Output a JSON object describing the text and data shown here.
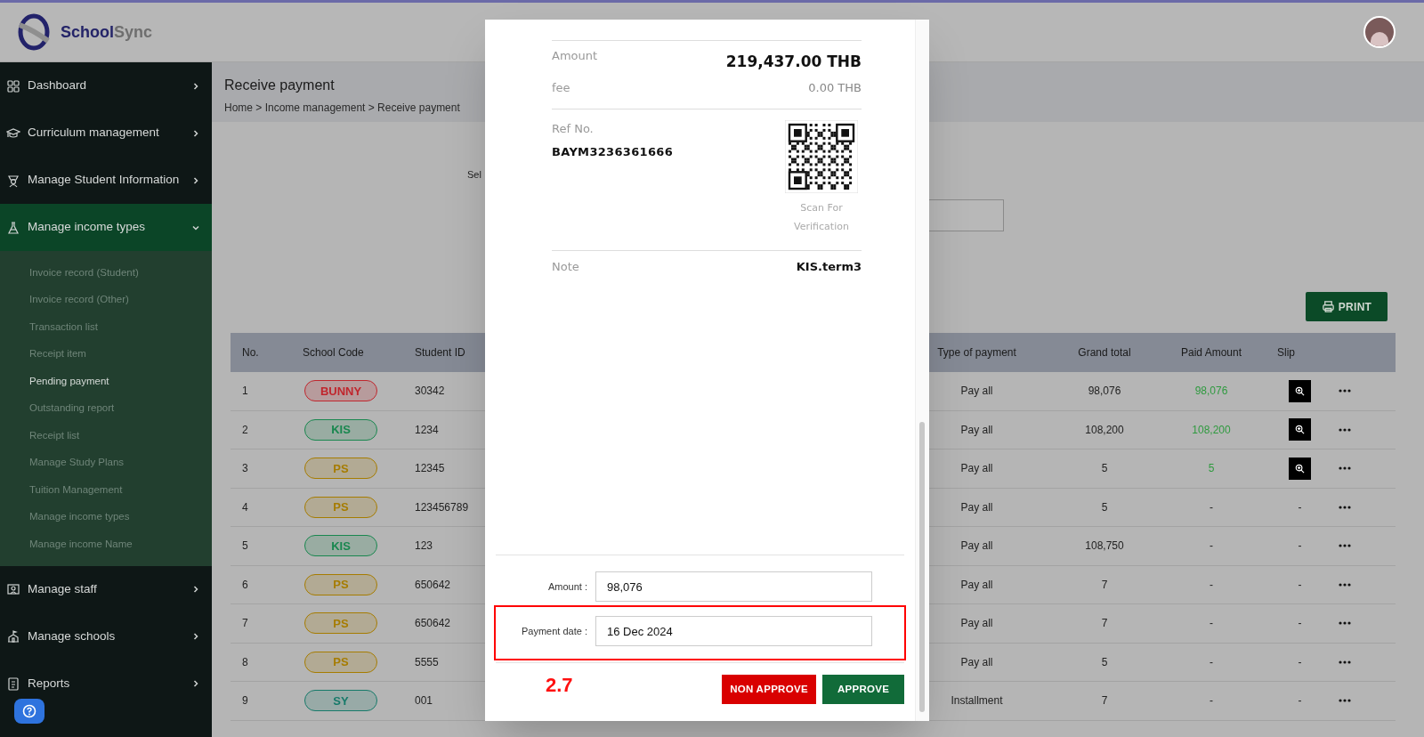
{
  "logo": {
    "primary": "School",
    "secondary": "Sync"
  },
  "sidebar": {
    "items": [
      {
        "label": "Dashboard",
        "expanded": false
      },
      {
        "label": "Curriculum management",
        "expanded": false
      },
      {
        "label": "Manage Student Information",
        "expanded": false
      },
      {
        "label": "Manage income types",
        "expanded": true,
        "children": [
          {
            "label": "Invoice record (Student)",
            "selected": false
          },
          {
            "label": "Invoice record (Other)",
            "selected": false
          },
          {
            "label": "Transaction list",
            "selected": false
          },
          {
            "label": "Receipt item",
            "selected": false
          },
          {
            "label": "Pending payment",
            "selected": true
          },
          {
            "label": "Outstanding report",
            "selected": false
          },
          {
            "label": "Receipt list",
            "selected": false
          },
          {
            "label": "Manage Study Plans",
            "selected": false
          },
          {
            "label": "Tuition Management",
            "selected": false
          },
          {
            "label": "Manage income types",
            "selected": false
          },
          {
            "label": "Manage income Name",
            "selected": false
          }
        ]
      },
      {
        "label": "Manage staff",
        "expanded": false
      },
      {
        "label": "Manage schools",
        "expanded": false
      },
      {
        "label": "Reports",
        "expanded": false
      }
    ]
  },
  "page": {
    "title": "Receive payment",
    "breadcrumb": "Home > Income management > Receive payment"
  },
  "filter": {
    "label": "Sel"
  },
  "print_button": "PRINT",
  "table": {
    "columns": [
      "No.",
      "School Code",
      "Student ID",
      "Type of payment",
      "Grand total",
      "Paid Amount",
      "Slip"
    ],
    "rows": [
      {
        "no": "1",
        "school_code": "BUNNY",
        "color": "#c0262d",
        "student_id": "30342",
        "type_of_payment": "Pay all",
        "grand_total": "98,076",
        "paid_amount": "98,076",
        "paid": true,
        "has_slip": true
      },
      {
        "no": "2",
        "school_code": "KIS",
        "color": "#19874f",
        "student_id": "1234",
        "type_of_payment": "Pay all",
        "grand_total": "108,200",
        "paid_amount": "108,200",
        "paid": true,
        "has_slip": true
      },
      {
        "no": "3",
        "school_code": "PS",
        "color": "#a67c00",
        "student_id": "12345",
        "type_of_payment": "Pay all",
        "grand_total": "5",
        "paid_amount": "5",
        "paid": true,
        "has_slip": true
      },
      {
        "no": "4",
        "school_code": "PS",
        "color": "#a67c00",
        "student_id": "123456789",
        "type_of_payment": "Pay all",
        "grand_total": "5",
        "paid_amount": "-",
        "paid": false,
        "has_slip": false,
        "slip": "-"
      },
      {
        "no": "5",
        "school_code": "KIS",
        "color": "#19874f",
        "student_id": "123",
        "type_of_payment": "Pay all",
        "grand_total": "108,750",
        "paid_amount": "-",
        "paid": false,
        "has_slip": false,
        "slip": "-"
      },
      {
        "no": "6",
        "school_code": "PS",
        "color": "#a67c00",
        "student_id": "650642",
        "type_of_payment": "Pay all",
        "grand_total": "7",
        "paid_amount": "-",
        "paid": false,
        "has_slip": false,
        "slip": "-"
      },
      {
        "no": "7",
        "school_code": "PS",
        "color": "#a67c00",
        "student_id": "650642",
        "type_of_payment": "Pay all",
        "grand_total": "7",
        "paid_amount": "-",
        "paid": false,
        "has_slip": false,
        "slip": "-"
      },
      {
        "no": "8",
        "school_code": "PS",
        "color": "#a67c00",
        "student_id": "5555",
        "type_of_payment": "Pay all",
        "grand_total": "5",
        "paid_amount": "-",
        "paid": false,
        "has_slip": false,
        "slip": "-"
      },
      {
        "no": "9",
        "school_code": "SY",
        "color": "#177a6a",
        "student_id": "001",
        "type_of_payment": "Installment",
        "grand_total": "7",
        "paid_amount": "-",
        "paid": false,
        "has_slip": false,
        "slip": "-"
      }
    ]
  },
  "modal": {
    "slip": {
      "amount_label": "Amount",
      "amount": "219,437.00 THB",
      "fee_label": "fee",
      "fee": "0.00 THB",
      "ref_label": "Ref No.",
      "ref_no": "BAYM3236361666",
      "scan_caption": "Scan For Verification",
      "note_label": "Note",
      "note": "KIS.term3"
    },
    "fields": [
      {
        "label": "Amount :",
        "value": "98,076",
        "highlighted": false
      },
      {
        "label": "Payment date :",
        "value": "16 Dec 2024",
        "highlighted": true
      }
    ],
    "annotation": "2.7",
    "buttons": [
      {
        "label": "NON APPROVE",
        "kind": "reject"
      },
      {
        "label": "APPROVE",
        "kind": "approve"
      }
    ]
  }
}
